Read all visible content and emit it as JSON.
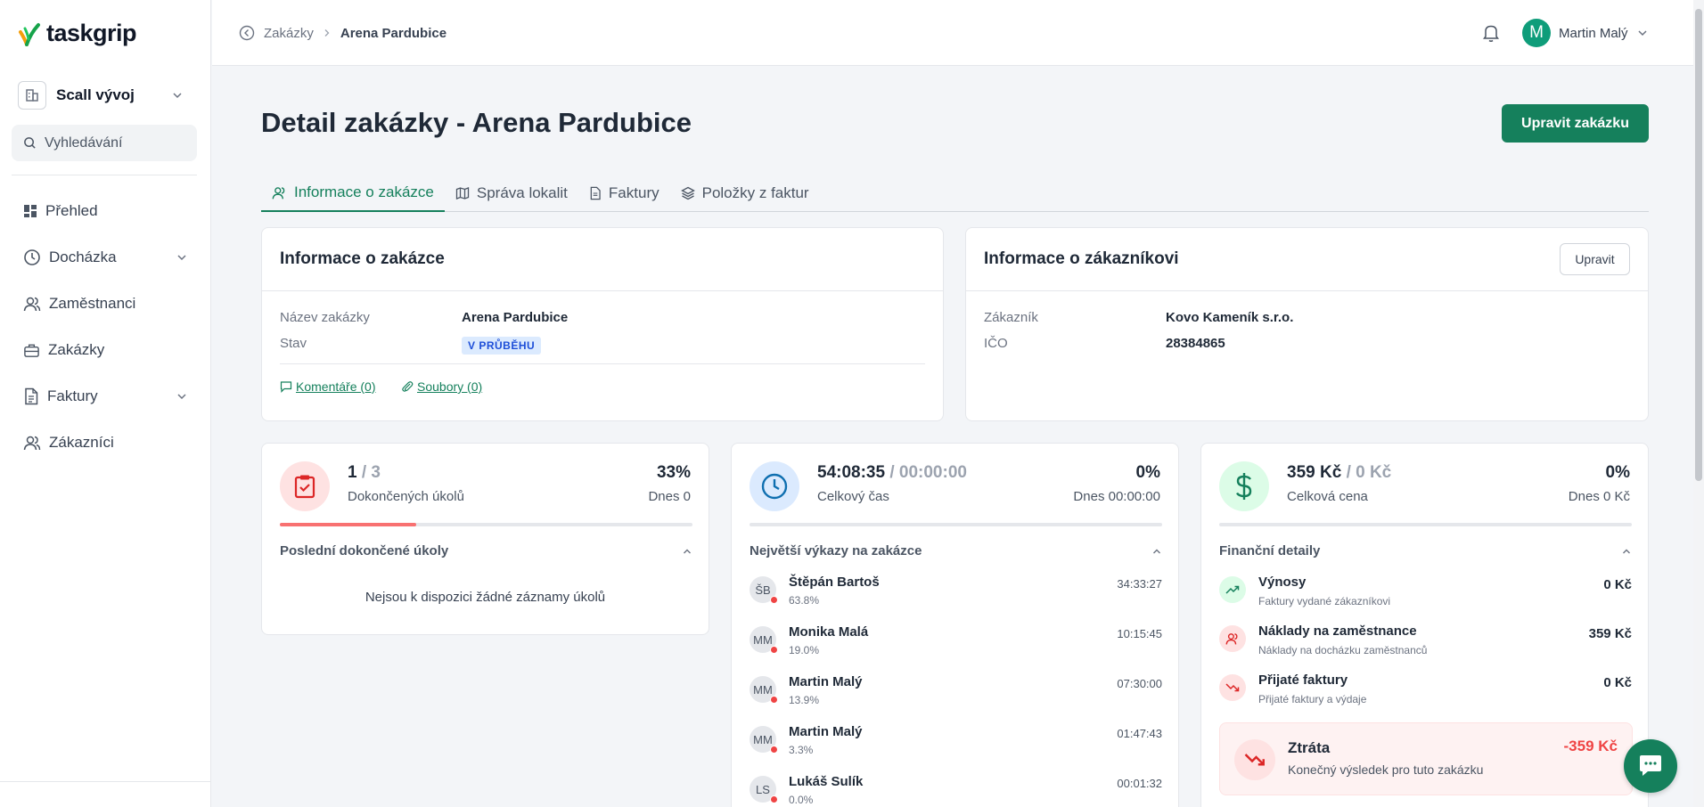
{
  "app": {
    "logo_text": "taskgrip",
    "org_name": "Scall vývoj"
  },
  "search": {
    "placeholder": "Vyhledávání"
  },
  "sidebar": {
    "items": [
      {
        "label": "Přehled",
        "icon": "dashboard-icon"
      },
      {
        "label": "Docházka",
        "icon": "clock-icon",
        "expandable": true
      },
      {
        "label": "Zaměstnanci",
        "icon": "users-icon"
      },
      {
        "label": "Zakázky",
        "icon": "briefcase-icon"
      },
      {
        "label": "Faktury",
        "icon": "document-icon",
        "expandable": true
      },
      {
        "label": "Zákazníci",
        "icon": "users-icon"
      }
    ]
  },
  "header": {
    "breadcrumb": {
      "parent": "Zakázky",
      "current": "Arena Pardubice"
    },
    "user": {
      "initial": "M",
      "name": "Martin Malý"
    }
  },
  "page": {
    "title": "Detail zakázky - Arena Pardubice",
    "edit_button": "Upravit zakázku"
  },
  "tabs": [
    {
      "label": "Informace o zakázce",
      "active": true
    },
    {
      "label": "Správa lokalit"
    },
    {
      "label": "Faktury"
    },
    {
      "label": "Položky z faktur"
    }
  ],
  "order_info": {
    "title": "Informace o zakázce",
    "name_label": "Název zakázky",
    "name_value": "Arena Pardubice",
    "status_label": "Stav",
    "status_value": "V PRŮBĚHU",
    "comments_link": "Komentáře (0)",
    "files_link": "Soubory (0)"
  },
  "customer_info": {
    "title": "Informace o zákazníkovi",
    "edit_button": "Upravit",
    "customer_label": "Zákazník",
    "customer_value": "Kovo Kameník s.r.o.",
    "ico_label": "IČO",
    "ico_value": "28384865"
  },
  "tasks": {
    "done": "1",
    "total": "/ 3",
    "subtitle": "Dokončených úkolů",
    "percent": "33%",
    "today": "Dnes 0",
    "progress": 0.33,
    "section_title": "Poslední dokončené úkoly",
    "empty_text": "Nejsou k dispozici žádné záznamy úkolů"
  },
  "time": {
    "value": "54:08:35",
    "planned": "/ 00:00:00",
    "subtitle": "Celkový čas",
    "percent": "0%",
    "today": "Dnes 00:00:00",
    "section_title": "Největší výkazy na zakázce",
    "rows": [
      {
        "initials": "ŠB",
        "name": "Štěpán Bartoš",
        "pct": "63.8%",
        "time": "34:33:27"
      },
      {
        "initials": "MM",
        "name": "Monika Malá",
        "pct": "19.0%",
        "time": "10:15:45"
      },
      {
        "initials": "MM",
        "name": "Martin Malý",
        "pct": "13.9%",
        "time": "07:30:00"
      },
      {
        "initials": "MM",
        "name": "Martin Malý",
        "pct": "3.3%",
        "time": "01:47:43"
      },
      {
        "initials": "LS",
        "name": "Lukáš Sulík",
        "pct": "0.0%",
        "time": "00:01:32"
      }
    ]
  },
  "finance": {
    "value": "359 Kč",
    "budget": "/ 0 Kč",
    "subtitle": "Celková cena",
    "percent": "0%",
    "today": "Dnes 0 Kč",
    "section_title": "Finanční detaily",
    "rows": [
      {
        "label": "Výnosy",
        "desc": "Faktury vydané zákazníkovi",
        "value": "0 Kč"
      },
      {
        "label": "Náklady na zaměstnance",
        "desc": "Náklady na docházku zaměstnanců",
        "value": "359 Kč"
      },
      {
        "label": "Přijaté faktury",
        "desc": "Přijaté faktury a výdaje",
        "value": "0 Kč"
      }
    ],
    "loss_title": "Ztráta",
    "loss_desc": "Konečný výsledek pro tuto zakázku",
    "loss_value": "-359 Kč"
  },
  "colors": {
    "brand": "#15805c",
    "danger": "#ef4444",
    "accent_blue": "#0f6fb0"
  }
}
